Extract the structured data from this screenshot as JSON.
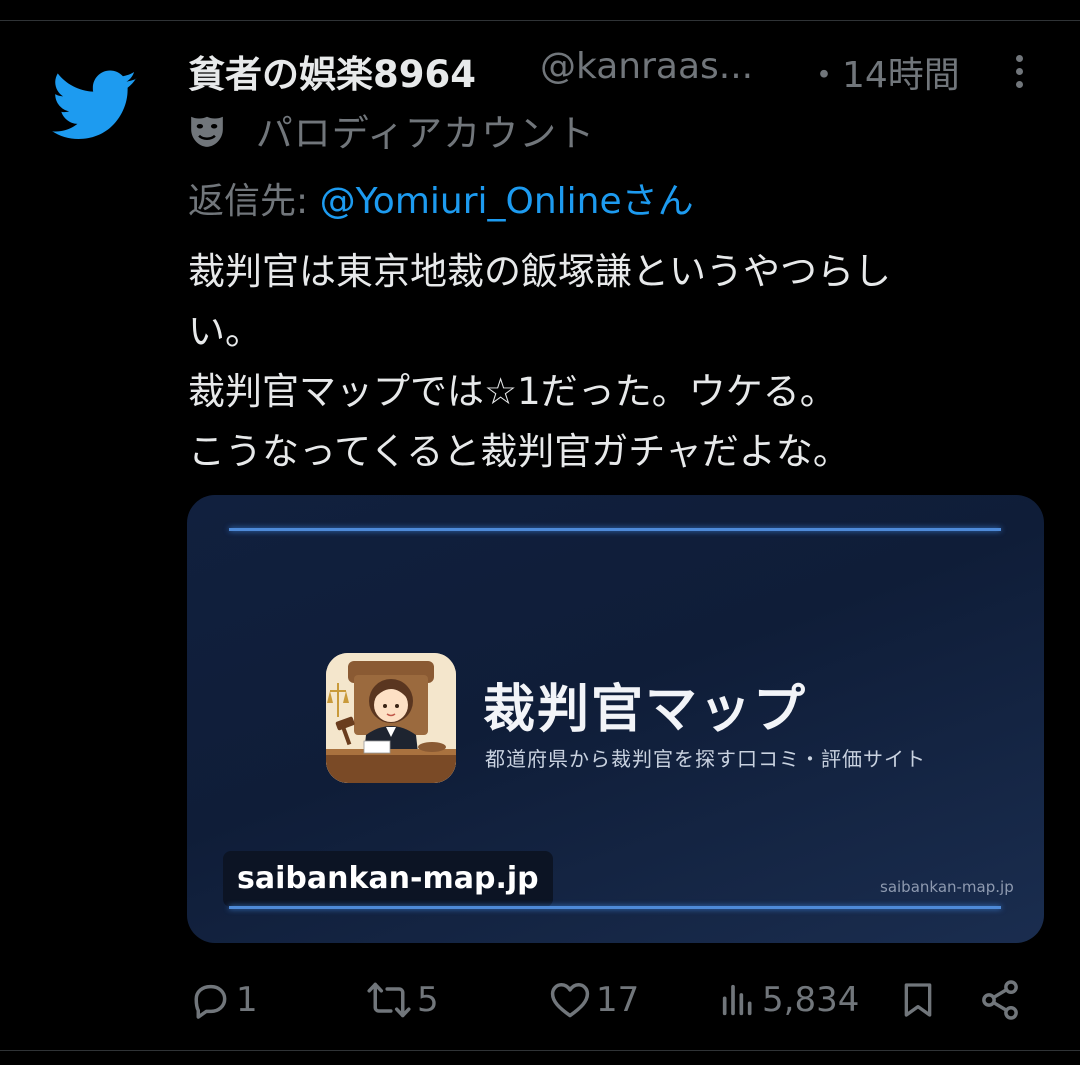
{
  "tweet": {
    "display_name": "貧者の娯楽8964",
    "handle": "@kanraas...",
    "time": "・14時間",
    "parody_label": "パロディアカウント",
    "reply_prefix": "返信先: ",
    "reply_to": "@Yomiuri_Onlineさん",
    "text_lines": [
      "裁判官は東京地裁の飯塚謙というやつらし",
      "い。",
      "裁判官マップでは☆1だった。ウケる。",
      "こうなってくると裁判官ガチャだよな。"
    ]
  },
  "card": {
    "title": "裁判官マップ",
    "subtitle": "都道府県から裁判官を探す口コミ・評価サイト",
    "domain_badge": "saibankan-map.jp",
    "domain_small": "saibankan-map.jp"
  },
  "actions": {
    "reply_count": "1",
    "retweet_count": "5",
    "like_count": "17",
    "views_count": "5,834"
  },
  "icons": {
    "logo": "twitter-bird-icon",
    "more": "more-vertical-icon",
    "parody": "mask-icon",
    "reply": "reply-icon",
    "retweet": "retweet-icon",
    "like": "heart-icon",
    "views": "views-icon",
    "bookmark": "bookmark-icon",
    "share": "share-icon"
  },
  "colors": {
    "background": "#000000",
    "text": "#e7e9ea",
    "secondary": "#71767b",
    "link": "#1d9bf0",
    "brand": "#1d9bf0"
  }
}
